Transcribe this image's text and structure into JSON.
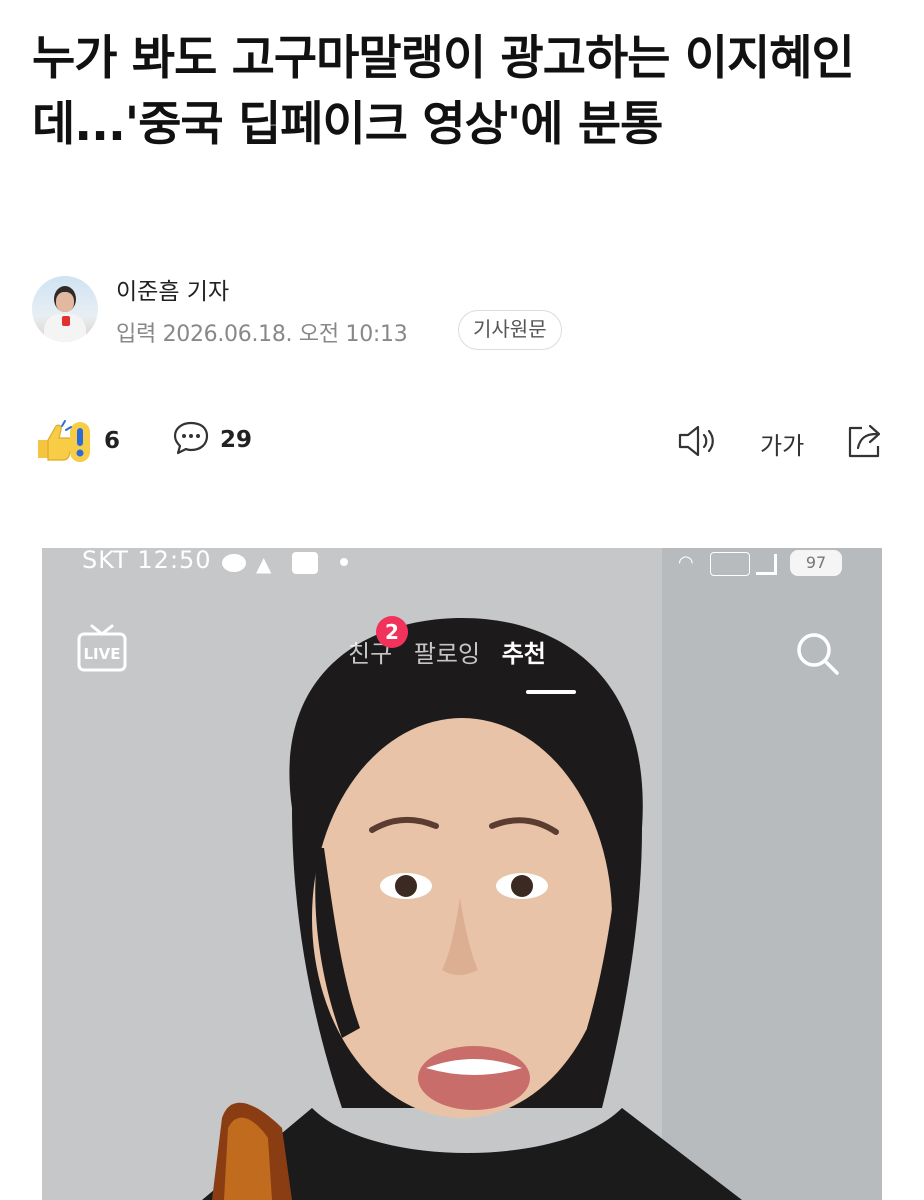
{
  "article": {
    "headline": "누가 봐도 고구마말랭이 광고하는 이지혜인데...'중국 딥페이크 영상'에 분통",
    "reporter": "이준흠 기자",
    "published": "입력 2026.06.18. 오전 10:13",
    "original_button": "기사원문"
  },
  "actions": {
    "reaction_count": "6",
    "comment_count": "29",
    "font_size_label": "가가"
  },
  "icons": {
    "reaction": "reaction-emoji-icon",
    "comment": "comment-bubble-icon",
    "speaker": "speaker-icon",
    "share": "share-icon"
  },
  "video": {
    "status_carrier": "SKT 12:50",
    "status_battery": "97",
    "live_label": "LIVE",
    "tabs": [
      "친구",
      "팔로잉",
      "추천"
    ],
    "active_tab": "추천",
    "notification_badge": "2"
  },
  "colors": {
    "badge": "#f1335b",
    "text": "#111111",
    "meta": "#888888"
  }
}
